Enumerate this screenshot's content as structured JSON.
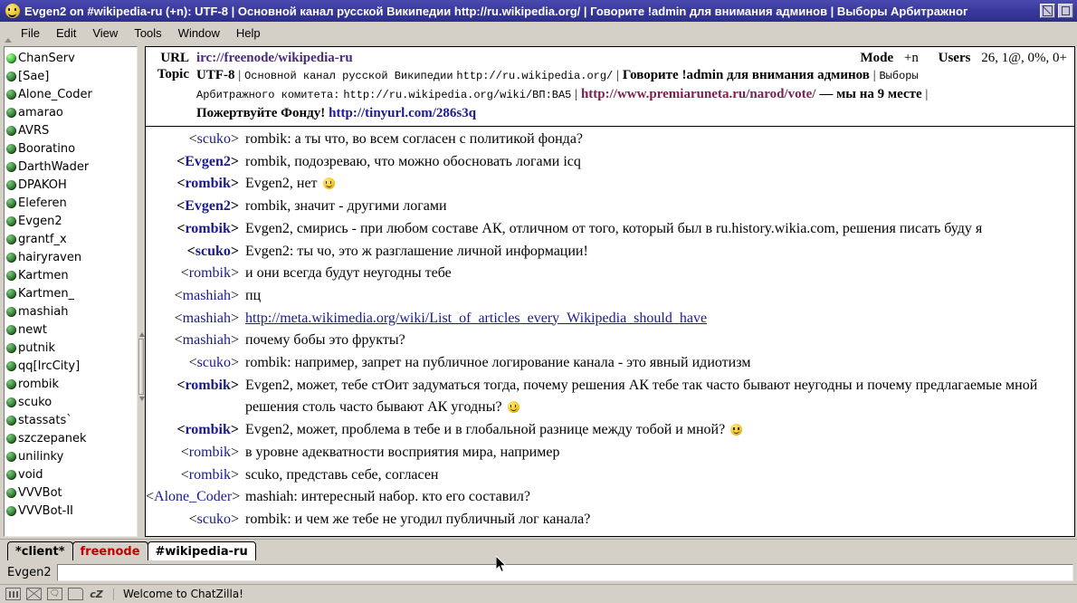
{
  "window": {
    "title": "Evgen2 on #wikipedia-ru (+n): UTF-8 | Основной канал русской Википедии http://ru.wikipedia.org/ | Говорите !admin для внимания админов | Выборы Арбитражног",
    "icon": "chatzilla-smiley-icon",
    "buttons": {
      "restore": "restore",
      "close": "close"
    }
  },
  "menubar": {
    "items": [
      {
        "label": "File"
      },
      {
        "label": "Edit"
      },
      {
        "label": "View"
      },
      {
        "label": "Tools"
      },
      {
        "label": "Window"
      },
      {
        "label": "Help"
      }
    ]
  },
  "userlist": {
    "users": [
      {
        "nick": "ChanServ",
        "status": "op"
      },
      {
        "nick": "[Sae]",
        "status": "normal"
      },
      {
        "nick": "Alone_Coder",
        "status": "normal"
      },
      {
        "nick": "amarao",
        "status": "normal"
      },
      {
        "nick": "AVRS",
        "status": "normal"
      },
      {
        "nick": "Booratino",
        "status": "normal"
      },
      {
        "nick": "DarthWader",
        "status": "normal"
      },
      {
        "nick": "DPAKOH",
        "status": "normal"
      },
      {
        "nick": "Eleferen",
        "status": "normal"
      },
      {
        "nick": "Evgen2",
        "status": "normal"
      },
      {
        "nick": "grantf_x",
        "status": "normal"
      },
      {
        "nick": "hairyraven",
        "status": "normal"
      },
      {
        "nick": "Kartmen",
        "status": "normal"
      },
      {
        "nick": "Kartmen_",
        "status": "normal"
      },
      {
        "nick": "mashiah",
        "status": "normal"
      },
      {
        "nick": "newt",
        "status": "normal"
      },
      {
        "nick": "putnik",
        "status": "normal"
      },
      {
        "nick": "qq[IrcCity]",
        "status": "normal"
      },
      {
        "nick": "rombik",
        "status": "normal"
      },
      {
        "nick": "scuko",
        "status": "normal"
      },
      {
        "nick": "stassats`",
        "status": "normal"
      },
      {
        "nick": "szczepanek",
        "status": "normal"
      },
      {
        "nick": "unilinky",
        "status": "normal"
      },
      {
        "nick": "void",
        "status": "normal"
      },
      {
        "nick": "VVVBot",
        "status": "normal"
      },
      {
        "nick": "VVVBot-II",
        "status": "normal"
      }
    ]
  },
  "header": {
    "url_label": "URL",
    "url_value": "irc://freenode/wikipedia-ru",
    "topic_label": "Topic",
    "mode_label": "Mode",
    "mode_value": "+n",
    "users_label": "Users",
    "users_value": "26, 1@, 0%, 0+",
    "topic_line1": {
      "encoding": "UTF-8",
      "sep1": "|",
      "text1": "Основной канал русской Википедии",
      "url1": "http://ru.wikipedia.org/",
      "sep2": "|",
      "text2": "Говорите !admin для внимания админов",
      "sep3": "|",
      "text3": "Выборы"
    },
    "topic_line2": {
      "text1": "Арбитражного комитета:",
      "url1": "http://ru.wikipedia.org/wiki/ВП:ВА5",
      "sep1": "|",
      "url2": "http://www.premiaruneta.ru/narod/vote/",
      "text2": "— мы на 9 месте",
      "sep2": "|"
    },
    "topic_line3": {
      "text1": "Пожертвуйте Фонду!",
      "url1": "http://tinyurl.com/286s3q"
    }
  },
  "chat": {
    "messages": [
      {
        "nick": "scuko",
        "bold": false,
        "text": "rombik: а ты что, во всем согласен с политикой фонда?"
      },
      {
        "nick": "Evgen2",
        "bold": true,
        "text": "rombik, подозреваю, что можно обосновать логами icq"
      },
      {
        "nick": "rombik",
        "bold": true,
        "text": "Evgen2, нет ",
        "smiley": true
      },
      {
        "nick": "Evgen2",
        "bold": true,
        "text": "rombik, значит - другими логами"
      },
      {
        "nick": "rombik",
        "bold": true,
        "text": "Evgen2, смирись - при любом составе АК, отличном от того, который был в ru.history.wikia.com, решения писать буду я"
      },
      {
        "nick": "scuko",
        "bold": true,
        "text": "Evgen2: ты чо, это ж разглашение личной информации!"
      },
      {
        "nick": "rombik",
        "bold": false,
        "text": "и они всегда будут неугодны тебе"
      },
      {
        "nick": "mashiah",
        "bold": false,
        "text": "пц"
      },
      {
        "nick": "mashiah",
        "bold": false,
        "link": "http://meta.wikimedia.org/wiki/List_of_articles_every_Wikipedia_should_have"
      },
      {
        "nick": "mashiah",
        "bold": false,
        "text": "почему бобы это фрукты?"
      },
      {
        "nick": "scuko",
        "bold": false,
        "text": "rombik: например, запрет на публичное логирование канала - это явный идиотизм"
      },
      {
        "nick": "rombik",
        "bold": true,
        "text": "Evgen2, может, тебе стОит задуматься тогда, почему решения АК тебе так часто бывают неугодны и почему предлагаемые мной решения столь часто бывают АК угодны? ",
        "smiley": true
      },
      {
        "nick": "rombik",
        "bold": true,
        "text": "Evgen2, может, проблема в тебе и в глобальной разнице между тобой и мной? ",
        "smiley": true
      },
      {
        "nick": "rombik",
        "bold": false,
        "text": "в уровне адекватности восприятия мира, например"
      },
      {
        "nick": "rombik",
        "bold": false,
        "text": "scuko, представь себе, согласен"
      },
      {
        "nick": "Alone_Coder",
        "bold": false,
        "text": "mashiah: интересный набор. кто его составил?"
      },
      {
        "nick": "scuko",
        "bold": false,
        "text": "rombik: и чем же тебе не угодил публичный лог канала?"
      }
    ]
  },
  "tabs": [
    {
      "label": "*client*",
      "kind": "client"
    },
    {
      "label": "freenode",
      "kind": "network"
    },
    {
      "label": "#wikipedia-ru",
      "kind": "channel"
    }
  ],
  "input": {
    "nick_label": "Evgen2",
    "value": "",
    "placeholder": ""
  },
  "statusbar": {
    "icons": [
      "bars-icon",
      "envelope-icon",
      "speech-bubble-icon",
      "page-icon",
      "chatzilla-cz-icon"
    ],
    "cz_label": "cZ",
    "message": "Welcome to ChatZilla!"
  },
  "colors": {
    "titlebar": "#2e2e8c",
    "chrome": "#d4d0c8",
    "nick_blue": "#1a1a8c",
    "link_purple": "#4b2a7b",
    "topic_magenta": "#7b1f4b",
    "tab_network_red": "#c00000"
  }
}
